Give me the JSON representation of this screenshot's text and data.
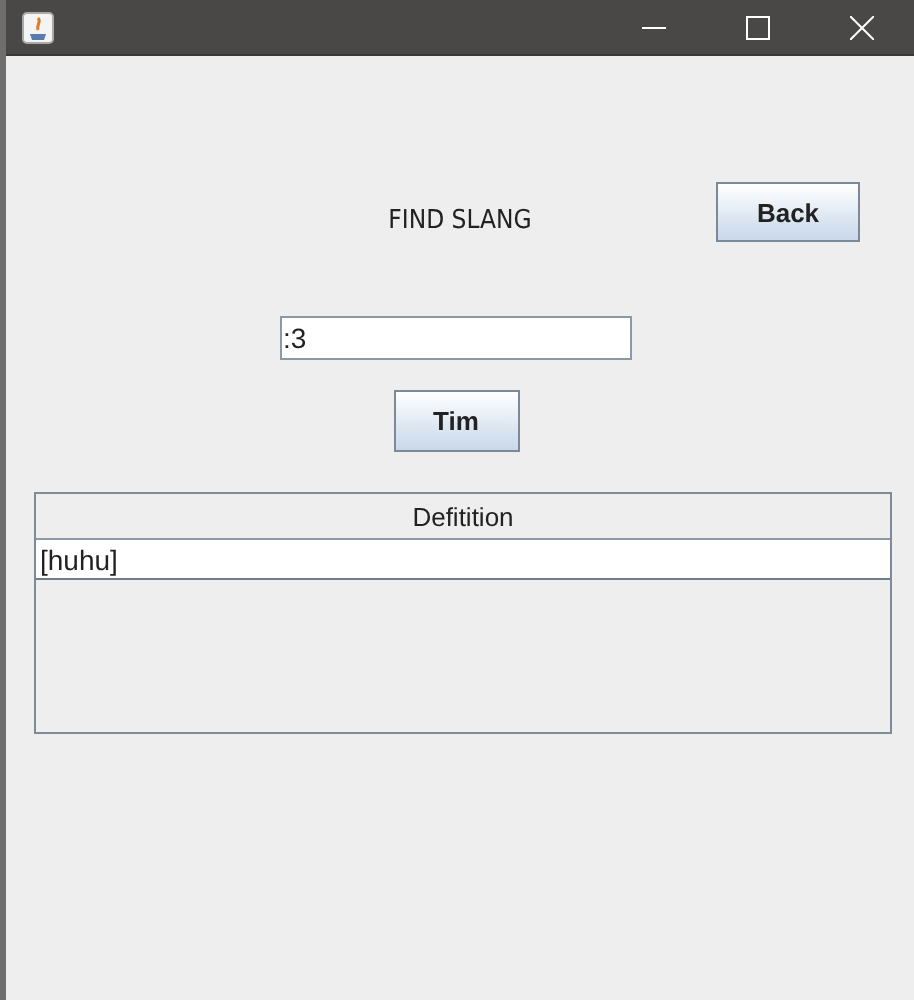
{
  "heading": "FIND SLANG",
  "back_button": "Back",
  "search": {
    "value": ":3"
  },
  "search_button": "Tim",
  "table": {
    "columns": [
      "Defitition"
    ],
    "rows": [
      [
        "[huhu]"
      ]
    ]
  }
}
